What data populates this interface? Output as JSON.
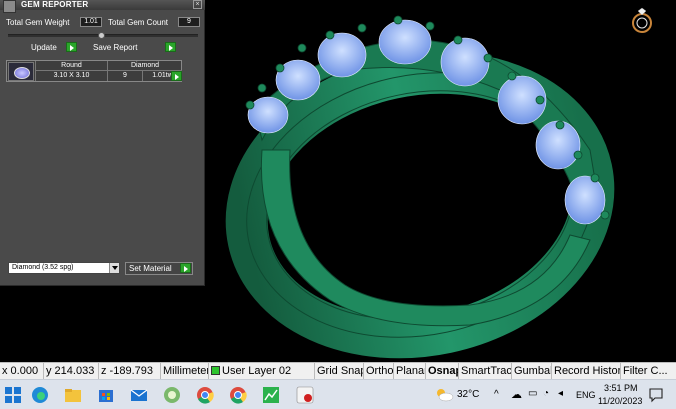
{
  "panel": {
    "title": "GEM REPORTER",
    "total_weight_label": "Total Gem Weight",
    "total_weight_value": "1.01",
    "total_count_label": "Total Gem Count",
    "total_count_value": "9",
    "update_label": "Update",
    "save_report_label": "Save Report",
    "table": {
      "shape": "Round",
      "size": "3.10 X 3.10",
      "material": "Diamond",
      "count": "9",
      "weight": "1.01tw"
    },
    "material_select": "Diamond    (3.52 spg)",
    "set_material_label": "Set Material"
  },
  "statusbar": {
    "x": "x 0.000",
    "y": "y 214.033",
    "z": "z -189.793",
    "units": "Millimeters",
    "layer": "User Layer 02",
    "grid_snap": "Grid Snap",
    "ortho": "Ortho",
    "planar": "Planar",
    "osnap": "Osnap",
    "smarttrack": "SmartTrack",
    "gumball": "Gumball",
    "record_history": "Record History",
    "filter": "Filter C..."
  },
  "taskbar": {
    "weather": "32°C",
    "language": "ENG",
    "time": "3:51 PM",
    "date": "11/20/2023"
  },
  "colors": {
    "ring_metal": "#1f8a5e",
    "gem": "#9bb8f5",
    "panel_bg": "#4a4a4a",
    "go_button": "#2aa52a"
  }
}
